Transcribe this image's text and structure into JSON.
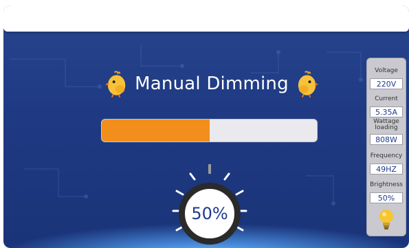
{
  "title": "Manual Dimming",
  "brightness_progress": 50,
  "knob": {
    "value": "50%"
  },
  "panel": {
    "items": [
      {
        "label": "Voltage",
        "value": "220V"
      },
      {
        "label": "Current",
        "value": "5.35A"
      },
      {
        "label": "Wattage loading",
        "value": "808W"
      },
      {
        "label": "Frequency",
        "value": "49HZ"
      },
      {
        "label": "Brightness",
        "value": "50%"
      }
    ]
  },
  "icons": {
    "title_left": "chick-icon",
    "title_right": "chick-icon",
    "panel_bottom": "lightbulb-icon"
  },
  "colors": {
    "background": "#1f3a83",
    "progress_fill": "#f28e1c",
    "text_accent": "#1d3b8c"
  }
}
